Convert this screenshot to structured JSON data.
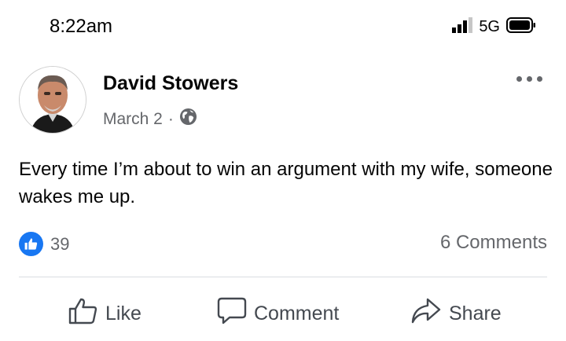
{
  "status_bar": {
    "time": "8:22am",
    "network": "5G"
  },
  "post": {
    "author": "David Stowers",
    "date": "March 2",
    "separator": "·",
    "text": "Every time I’m about to win an argument with my wife, someone wakes me up.",
    "likes": "39",
    "comments": "6 Comments"
  },
  "actions": {
    "like": "Like",
    "comment": "Comment",
    "share": "Share"
  },
  "colors": {
    "like_blue": "#1877f2",
    "meta_gray": "#65676b",
    "action_gray": "#444950"
  },
  "icons": [
    "signal-bars-icon",
    "battery-icon",
    "globe-icon",
    "more-dots-icon",
    "like-badge-icon",
    "thumbs-up-icon",
    "comment-bubble-icon",
    "share-arrow-icon"
  ]
}
